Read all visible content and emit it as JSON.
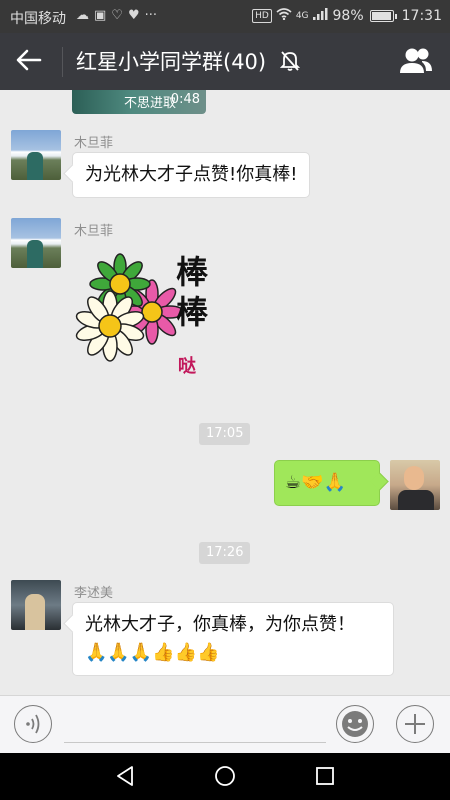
{
  "status_bar": {
    "carrier": "中国移动",
    "hd_badge": "HD",
    "network": "4G",
    "battery_text": "98%",
    "battery_level": 0.98,
    "time": "17:31"
  },
  "header": {
    "title": "红星小学同学群(40)",
    "back_icon": "back-arrow-icon",
    "mute_icon": "bell-off-icon",
    "group_icon": "group-members-icon"
  },
  "chat": {
    "video_preview": {
      "caption": "不思进取",
      "duration": "0:48"
    },
    "messages": [
      {
        "sender": "木旦菲",
        "text": "为光林大才子点赞!你真棒!"
      },
      {
        "sender": "木旦菲",
        "sticker_line1": "棒",
        "sticker_line2": "棒",
        "sticker_line3": "哒"
      },
      {
        "timestamp": "17:05"
      },
      {
        "outgoing_emoji": "☕🤝🙏"
      },
      {
        "timestamp": "17:26"
      },
      {
        "sender": "李述美",
        "text": "光林大才子，你真棒，为你点赞！",
        "emoji": "🙏🙏🙏👍👍👍"
      }
    ]
  },
  "input_bar": {
    "voice_icon": "voice-icon",
    "emoji_icon": "emoji-icon",
    "plus_icon": "plus-icon"
  },
  "nav_bar": {
    "back_icon": "nav-back-icon",
    "home_icon": "nav-home-icon",
    "recent_icon": "nav-recent-icon"
  },
  "colors": {
    "header_bg": "#393a3f",
    "chat_bg": "#ebebeb",
    "my_bubble": "#a0e75a"
  }
}
